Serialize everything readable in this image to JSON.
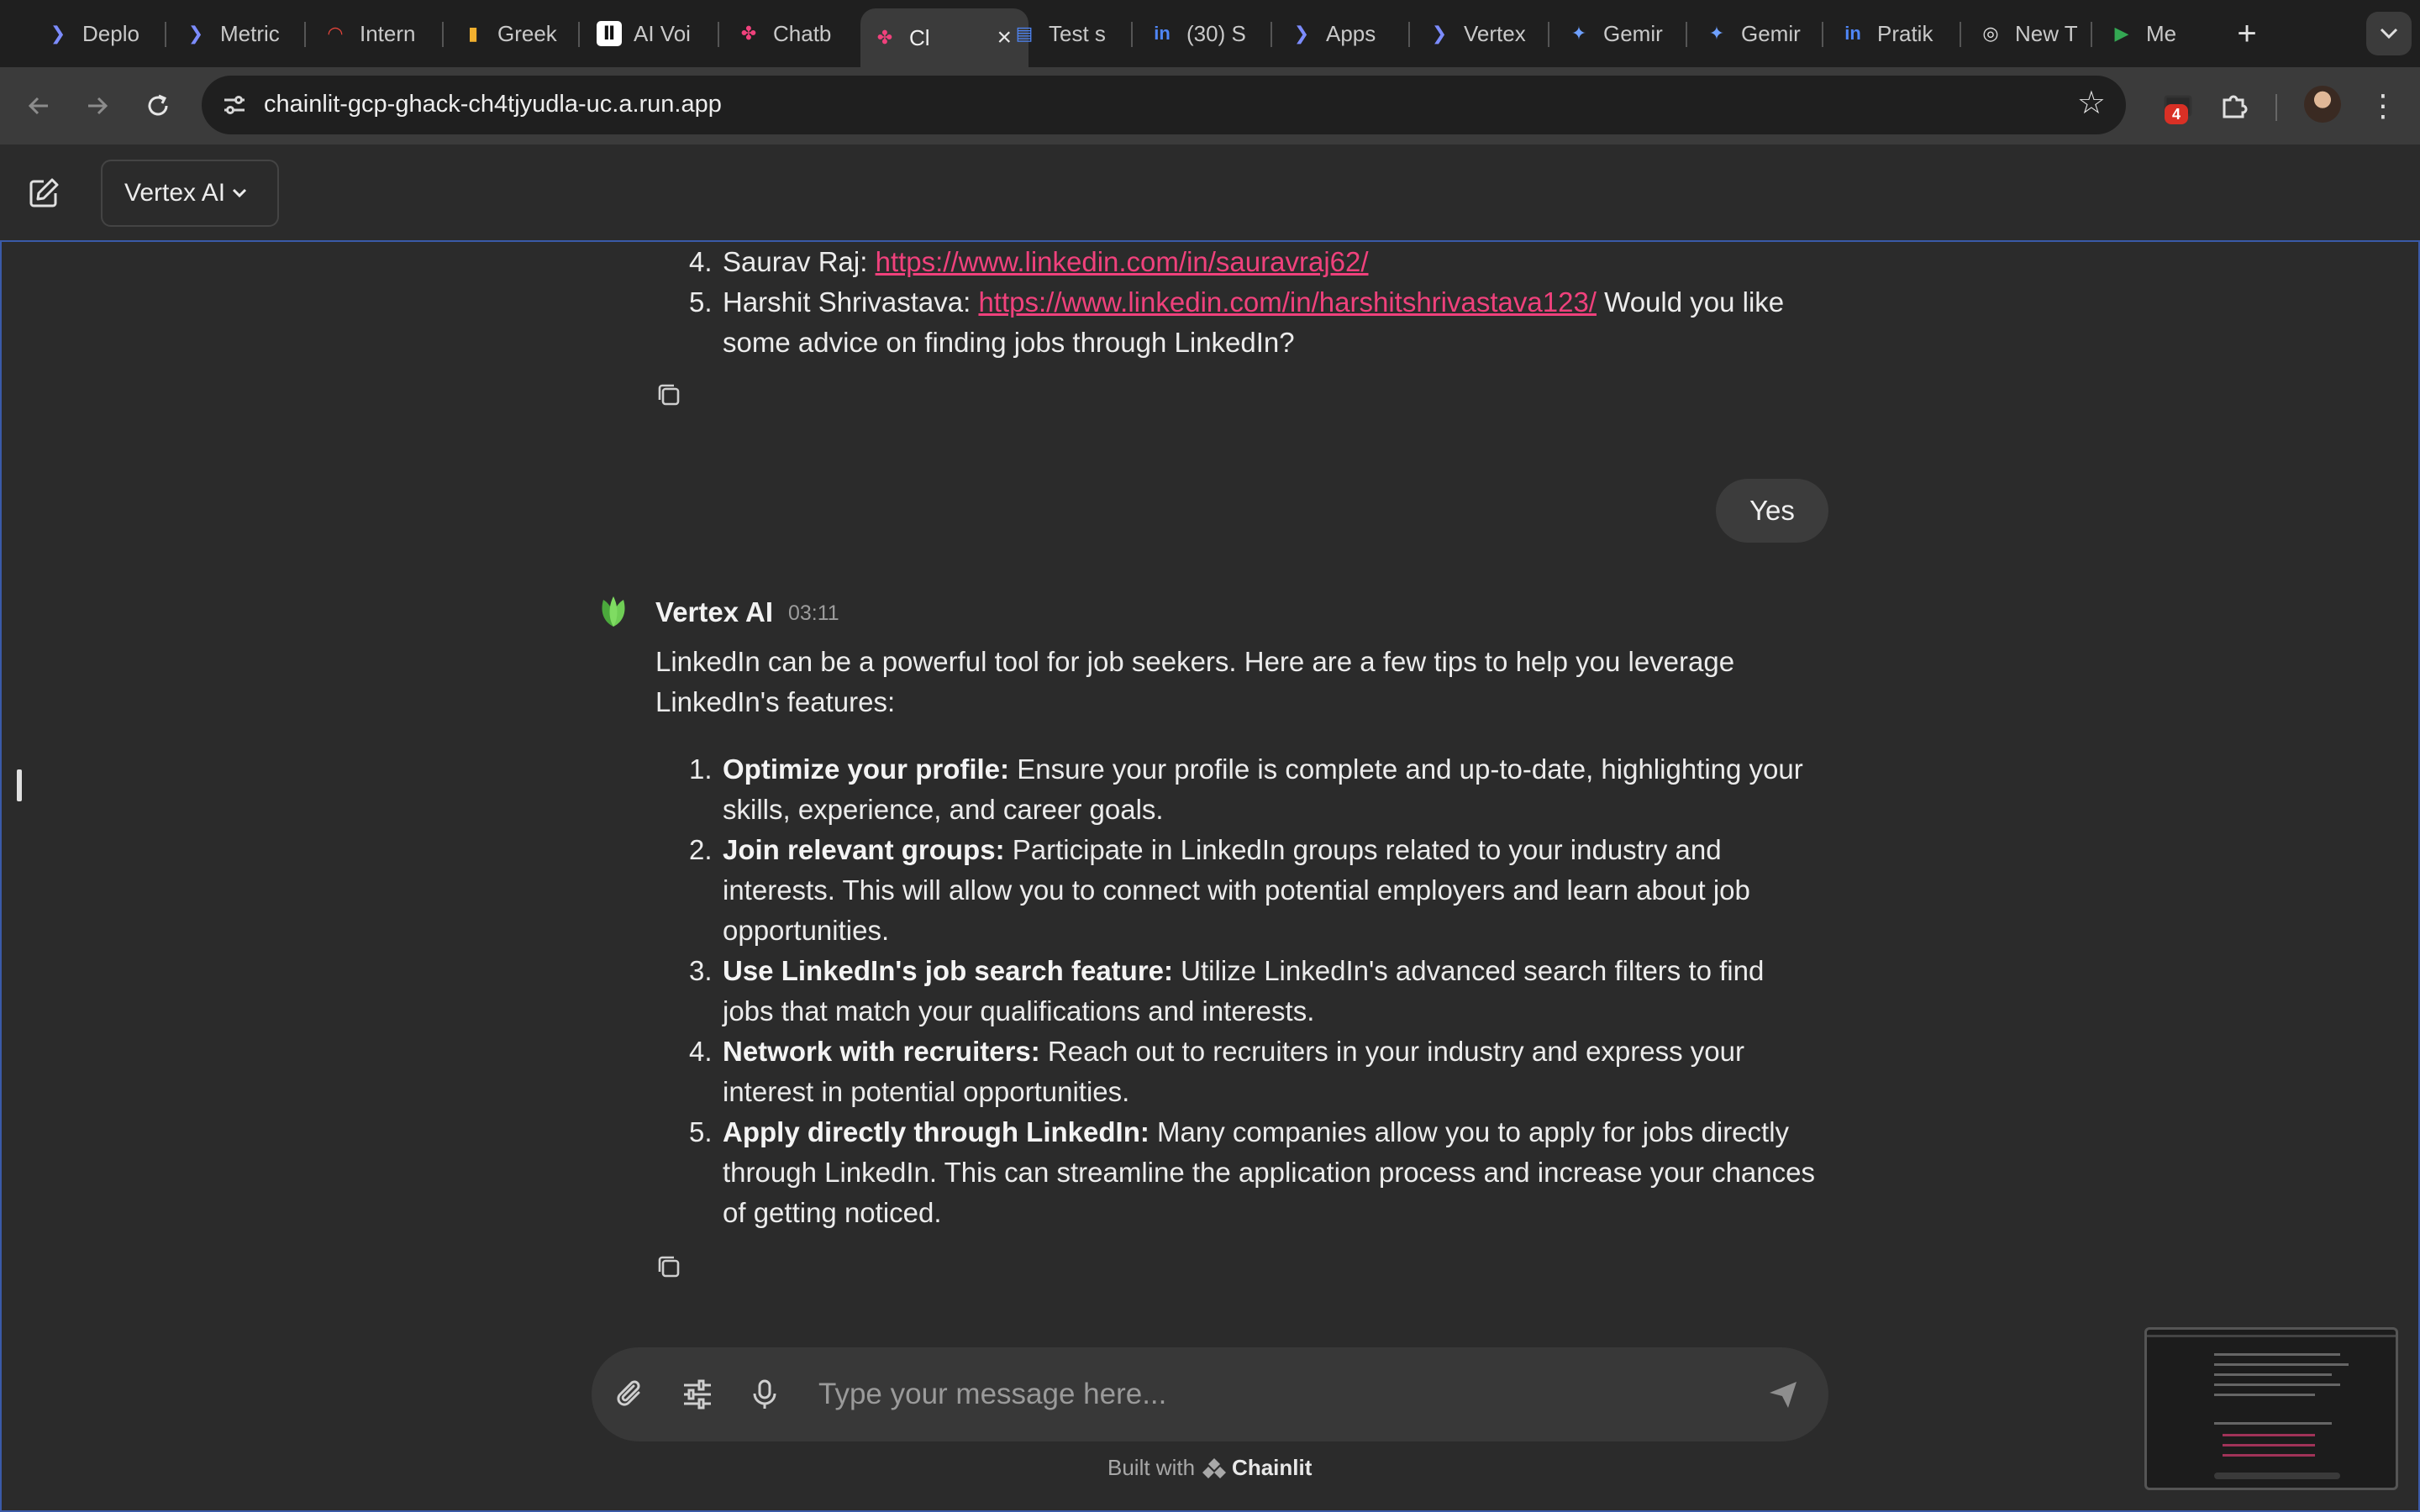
{
  "browser": {
    "tabs": [
      {
        "title": "Deplo",
        "icon": "deploy-icon",
        "color": "#7c8cff"
      },
      {
        "title": "Metric",
        "icon": "metrics-icon",
        "color": "#7c8cff"
      },
      {
        "title": "Intern",
        "icon": "gauge-icon",
        "color": "#e0443a"
      },
      {
        "title": "Greek",
        "icon": "bar-chart-icon",
        "color": "#f2b02e"
      },
      {
        "title": "AI Voi",
        "icon": "ai-voice-icon",
        "color": "#ffffff"
      },
      {
        "title": "Chatb",
        "icon": "chainlit-icon",
        "color": "#f0417c"
      },
      {
        "title": "Cl",
        "icon": "chainlit-icon",
        "color": "#f0417c",
        "active": true
      },
      {
        "title": "Test s",
        "icon": "google-docs-icon",
        "color": "#4f86f7"
      },
      {
        "title": "(30) S",
        "icon": "linkedin-icon",
        "color": "#4f86f7"
      },
      {
        "title": "Apps",
        "icon": "vertex-icon",
        "color": "#7c8cff"
      },
      {
        "title": "Vertex",
        "icon": "vertex-icon",
        "color": "#7c8cff"
      },
      {
        "title": "Gemir",
        "icon": "gemini-icon",
        "color": "#6ea0ff"
      },
      {
        "title": "Gemir",
        "icon": "gemini-icon",
        "color": "#6ea0ff"
      },
      {
        "title": "Pratik",
        "icon": "linkedin-icon",
        "color": "#4f86f7"
      },
      {
        "title": "New T",
        "icon": "chrome-icon",
        "color": "#e0e0e0"
      },
      {
        "title": "Me",
        "icon": "meet-icon",
        "color": "#34a853"
      }
    ],
    "url": "chainlit-gcp-ghack-ch4tjyudla-uc.a.run.app",
    "extension_badge": "4"
  },
  "header": {
    "model_label": "Vertex AI"
  },
  "conversation": {
    "previous_list": [
      {
        "num": "4.",
        "text": "Saurav Raj: ",
        "link": "https://www.linkedin.com/in/sauravraj62/",
        "after": ""
      },
      {
        "num": "5.",
        "text": "Harshit Shrivastava: ",
        "link": "https://www.linkedin.com/in/harshitshrivastava123/",
        "after": " Would you like some advice on finding jobs through LinkedIn?"
      }
    ],
    "user_message": "Yes",
    "bot": {
      "name": "Vertex AI",
      "time": "03:11",
      "intro": "LinkedIn can be a powerful tool for job seekers. Here are a few tips to help you leverage LinkedIn's features:",
      "tips": [
        {
          "num": "1.",
          "title": "Optimize your profile:",
          "body": " Ensure your profile is complete and up-to-date, highlighting your skills, experience, and career goals."
        },
        {
          "num": "2.",
          "title": "Join relevant groups:",
          "body": " Participate in LinkedIn groups related to your industry and interests. This will allow you to connect with potential employers and learn about job opportunities."
        },
        {
          "num": "3.",
          "title": "Use LinkedIn's job search feature:",
          "body": " Utilize LinkedIn's advanced search filters to find jobs that match your qualifications and interests."
        },
        {
          "num": "4.",
          "title": "Network with recruiters:",
          "body": " Reach out to recruiters in your industry and express your interest in potential opportunities."
        },
        {
          "num": "5.",
          "title": "Apply directly through LinkedIn:",
          "body": " Many companies allow you to apply for jobs directly through LinkedIn. This can streamline the application process and increase your chances of getting noticed."
        }
      ]
    }
  },
  "composer": {
    "placeholder": "Type your message here..."
  },
  "footer": {
    "built_with": "Built with",
    "brand": "Chainlit"
  },
  "colors": {
    "link": "#f0417c",
    "focus_border": "#3a5aa8",
    "bot_avatar": "#57b947"
  }
}
